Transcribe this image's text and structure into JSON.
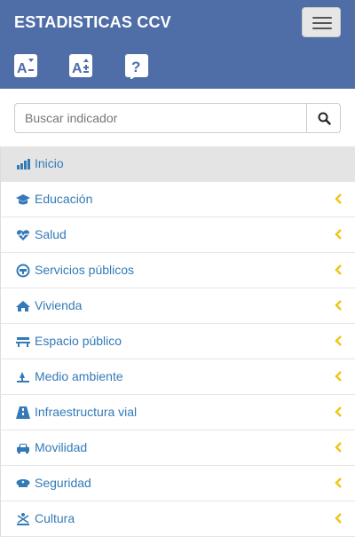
{
  "header": {
    "title": "ESTADISTICAS CCV"
  },
  "colors": {
    "header_bg": "#4f6ea8",
    "link": "#337ab7",
    "chevron": "#f0c419",
    "active_bg": "#e4e4e4"
  },
  "toolbar": {
    "decrease_font_icon": "font-decrease-icon",
    "increase_font_icon": "font-increase-icon",
    "help_icon": "help-icon"
  },
  "search": {
    "placeholder": "Buscar indicador",
    "value": ""
  },
  "nav": {
    "items": [
      {
        "label": "Inicio",
        "icon": "bar-chart-icon",
        "active": true,
        "has_submenu": false
      },
      {
        "label": "Educación",
        "icon": "graduation-cap-icon",
        "active": false,
        "has_submenu": true
      },
      {
        "label": "Salud",
        "icon": "heartbeat-icon",
        "active": false,
        "has_submenu": true
      },
      {
        "label": "Servicios públicos",
        "icon": "faucet-icon",
        "active": false,
        "has_submenu": true
      },
      {
        "label": "Vivienda",
        "icon": "home-icon",
        "active": false,
        "has_submenu": true
      },
      {
        "label": "Espacio público",
        "icon": "bench-icon",
        "active": false,
        "has_submenu": true
      },
      {
        "label": "Medio ambiente",
        "icon": "tree-icon",
        "active": false,
        "has_submenu": true
      },
      {
        "label": "Infraestructura vial",
        "icon": "road-icon",
        "active": false,
        "has_submenu": true
      },
      {
        "label": "Movilidad",
        "icon": "car-icon",
        "active": false,
        "has_submenu": true
      },
      {
        "label": "Seguridad",
        "icon": "police-cap-icon",
        "active": false,
        "has_submenu": true
      },
      {
        "label": "Cultura",
        "icon": "culture-icon",
        "active": false,
        "has_submenu": true
      }
    ]
  }
}
